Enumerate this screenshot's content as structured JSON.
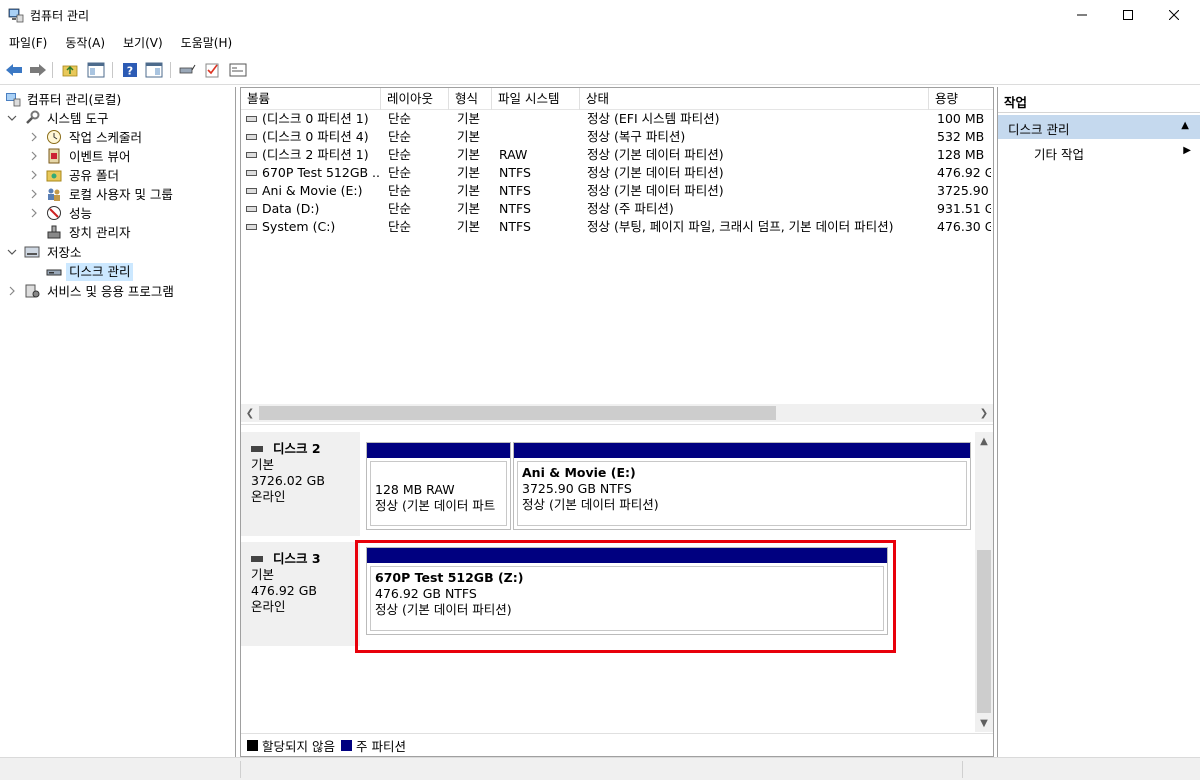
{
  "window": {
    "title": "컴퓨터 관리"
  },
  "menu": [
    "파일(F)",
    "동작(A)",
    "보기(V)",
    "도움말(H)"
  ],
  "tree": [
    {
      "label": "컴퓨터 관리(로컬)",
      "level": 0,
      "expander": "",
      "icon": "computer-management-icon"
    },
    {
      "label": "시스템 도구",
      "level": 1,
      "expander": "expanded",
      "icon": "system-tools-icon"
    },
    {
      "label": "작업 스케줄러",
      "level": 2,
      "expander": "collapsed",
      "icon": "task-scheduler-icon"
    },
    {
      "label": "이벤트 뷰어",
      "level": 2,
      "expander": "collapsed",
      "icon": "event-viewer-icon"
    },
    {
      "label": "공유 폴더",
      "level": 2,
      "expander": "collapsed",
      "icon": "shared-folders-icon"
    },
    {
      "label": "로컬 사용자 및 그룹",
      "level": 2,
      "expander": "collapsed",
      "icon": "local-users-icon"
    },
    {
      "label": "성능",
      "level": 2,
      "expander": "collapsed",
      "icon": "performance-icon"
    },
    {
      "label": "장치 관리자",
      "level": 2,
      "expander": "",
      "icon": "device-manager-icon"
    },
    {
      "label": "저장소",
      "level": 1,
      "expander": "expanded",
      "icon": "storage-icon"
    },
    {
      "label": "디스크 관리",
      "level": 2,
      "expander": "",
      "icon": "disk-management-icon",
      "selected": true
    },
    {
      "label": "서비스 및 응용 프로그램",
      "level": 1,
      "expander": "collapsed",
      "icon": "services-icon"
    }
  ],
  "columns": [
    "볼륨",
    "레이아웃",
    "형식",
    "파일 시스템",
    "상태",
    "용량"
  ],
  "volumes": [
    {
      "name": "(디스크 0 파티션 1)",
      "layout": "단순",
      "type": "기본",
      "fs": "",
      "status": "정상 (EFI 시스템 파티션)",
      "capacity": "100 MB"
    },
    {
      "name": "(디스크 0 파티션 4)",
      "layout": "단순",
      "type": "기본",
      "fs": "",
      "status": "정상 (복구 파티션)",
      "capacity": "532 MB"
    },
    {
      "name": "(디스크 2 파티션 1)",
      "layout": "단순",
      "type": "기본",
      "fs": "RAW",
      "status": "정상 (기본 데이터 파티션)",
      "capacity": "128 MB"
    },
    {
      "name": "670P Test 512GB ...",
      "layout": "단순",
      "type": "기본",
      "fs": "NTFS",
      "status": "정상 (기본 데이터 파티션)",
      "capacity": "476.92 G"
    },
    {
      "name": "Ani & Movie (E:)",
      "layout": "단순",
      "type": "기본",
      "fs": "NTFS",
      "status": "정상 (기본 데이터 파티션)",
      "capacity": "3725.90 ("
    },
    {
      "name": "Data (D:)",
      "layout": "단순",
      "type": "기본",
      "fs": "NTFS",
      "status": "정상 (주 파티션)",
      "capacity": "931.51 G"
    },
    {
      "name": "System (C:)",
      "layout": "단순",
      "type": "기본",
      "fs": "NTFS",
      "status": "정상 (부팅, 페이지 파일, 크래시 덤프, 기본 데이터 파티션)",
      "capacity": "476.30 G"
    }
  ],
  "disks": [
    {
      "name": "디스크 2",
      "type": "기본",
      "size": "3726.02 GB",
      "state": "온라인",
      "partitions": [
        {
          "title": "",
          "line1": "128 MB RAW",
          "line2": "정상 (기본 데이터 파트"
        },
        {
          "title": "Ani & Movie  (E:)",
          "line1": "3725.90 GB NTFS",
          "line2": "정상 (기본 데이터 파티션)"
        }
      ]
    },
    {
      "name": "디스크 3",
      "type": "기본",
      "size": "476.92 GB",
      "state": "온라인",
      "partitions": [
        {
          "title": "670P Test 512GB  (Z:)",
          "line1": "476.92 GB NTFS",
          "line2": "정상 (기본 데이터 파티션)"
        }
      ]
    }
  ],
  "legend": [
    {
      "label": "할당되지 않음",
      "color": "#000000"
    },
    {
      "label": "주 파티션",
      "color": "#000080"
    }
  ],
  "actions": {
    "header": "작업",
    "section": "디스크 관리",
    "item": "기타 작업"
  },
  "colors": {
    "partition_bar": "#000080",
    "highlight": "#e8000b",
    "selection": "#cce8ff",
    "action_section": "#c5d9ee"
  }
}
